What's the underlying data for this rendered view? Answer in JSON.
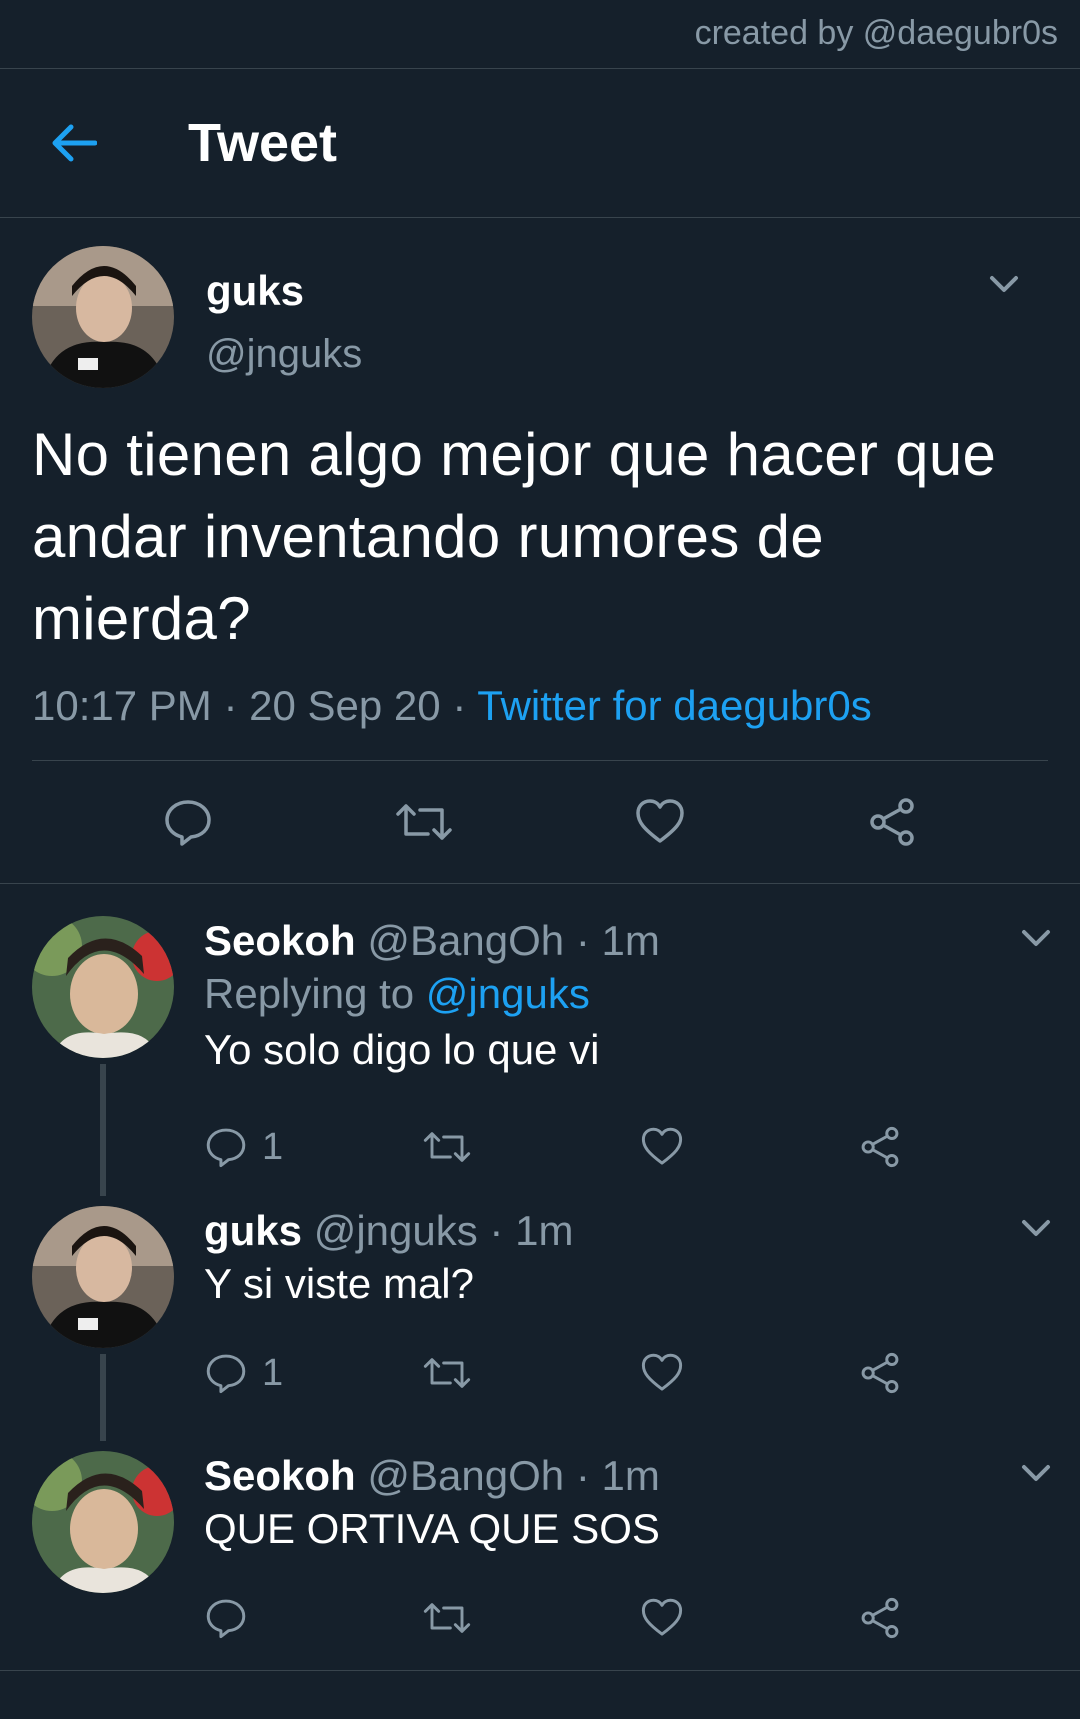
{
  "credit": "created by @daegubr0s",
  "header": {
    "title": "Tweet"
  },
  "main_tweet": {
    "name": "guks",
    "handle": "@jnguks",
    "text": "No tienen algo mejor que hacer que andar inventando rumores de mierda?",
    "time": "10:17 PM",
    "date": "20 Sep 20",
    "source": "Twitter for daegubr0s"
  },
  "replies": [
    {
      "name": "Seokoh",
      "handle": "@BangOh",
      "time": "1m",
      "replying_label": "Replying to",
      "replying_to": "@jnguks",
      "text": "Yo solo digo lo que vi",
      "reply_count": "1"
    },
    {
      "name": "guks",
      "handle": "@jnguks",
      "time": "1m",
      "text": "Y si viste mal?",
      "reply_count": "1"
    },
    {
      "name": "Seokoh",
      "handle": "@BangOh",
      "time": "1m",
      "text": "QUE ORTIVA QUE SOS",
      "reply_count": ""
    }
  ],
  "colors": {
    "background": "#15202b",
    "accent": "#1da1f2",
    "muted": "#8899a6",
    "divider": "#38444d"
  },
  "separator": "·"
}
